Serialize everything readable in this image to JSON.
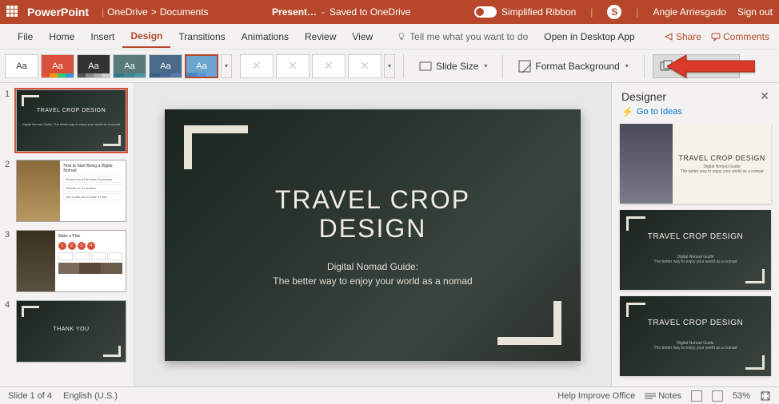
{
  "titlebar": {
    "app": "PowerPoint",
    "location_root": "OneDrive",
    "location_sep": ">",
    "location_folder": "Documents",
    "doc_name": "Present…",
    "saved_status": "Saved to OneDrive",
    "simplified_ribbon": "Simplified Ribbon",
    "skype": "S",
    "user": "Angie Arriesgado",
    "signout": "Sign out"
  },
  "menubar": {
    "tabs": [
      "File",
      "Home",
      "Insert",
      "Design",
      "Transitions",
      "Animations",
      "Review",
      "View"
    ],
    "active_index": 3,
    "tell_me": "Tell me what you want to do",
    "open_desktop": "Open in Desktop App",
    "share": "Share",
    "comments": "Comments"
  },
  "ribbon": {
    "theme_label": "Aa",
    "slide_size": "Slide Size",
    "format_bg": "Format Background",
    "design_ideas": "Design Ideas"
  },
  "thumbnails": [
    {
      "num": "1",
      "type": "title",
      "title": "TRAVEL CROP DESIGN",
      "sub": "Digital Nomad Guide: The better way to enjoy your world as a nomad",
      "selected": true
    },
    {
      "num": "2",
      "type": "list",
      "title": "How to Start Being a Digital Nomad",
      "items": [
        "Reduce and Eliminate Expenses",
        "Decide on a Location",
        "Set Goals and Create a Plan"
      ]
    },
    {
      "num": "3",
      "type": "plan",
      "title": "Make a Plan",
      "steps": [
        "1",
        "2",
        "3",
        "4"
      ]
    },
    {
      "num": "4",
      "type": "title",
      "title": "THANK YOU",
      "sub": ""
    }
  ],
  "slide": {
    "title_l1": "TRAVEL CROP",
    "title_l2": "DESIGN",
    "sub_l1": "Digital Nomad Guide:",
    "sub_l2": "The better way to enjoy your world as a nomad"
  },
  "designer": {
    "title": "Designer",
    "goto": "Go to Ideas",
    "card_title": "TRAVEL CROP DESIGN",
    "card_sub1": "Digital Nomad Guide",
    "card_sub2": "The better way to enjoy your world as a nomad"
  },
  "statusbar": {
    "slide_info": "Slide 1 of 4",
    "language": "English (U.S.)",
    "help_improve": "Help Improve Office",
    "notes": "Notes",
    "zoom": "53%"
  }
}
